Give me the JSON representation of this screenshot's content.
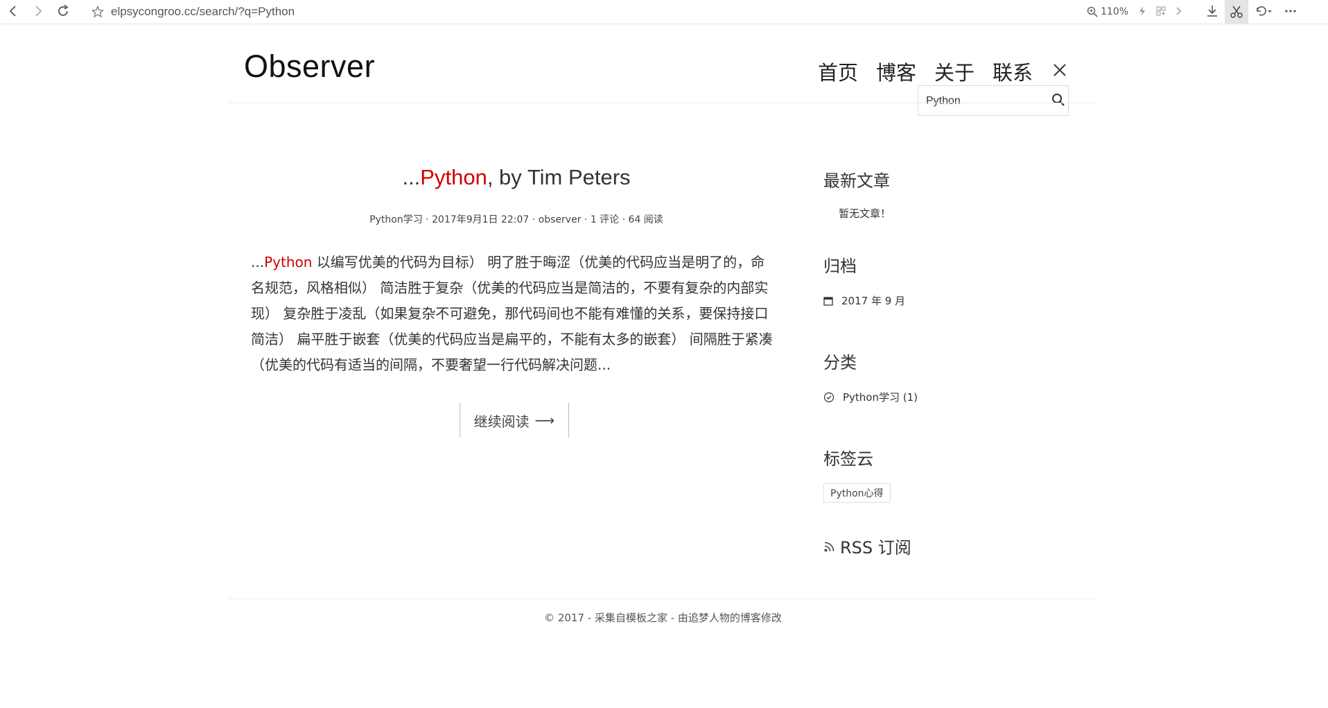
{
  "browser": {
    "url": "elpsycongroo.cc/search/?q=Python",
    "zoom": "110%",
    "icons": [
      "back-icon",
      "forward-icon",
      "reload-icon",
      "star-icon",
      "zoom-icon",
      "lightning-icon",
      "qr-icon",
      "chevron-right-icon",
      "download-icon",
      "scissors-icon",
      "undo-icon",
      "more-icon"
    ]
  },
  "site": {
    "title": "Observer"
  },
  "nav": {
    "items": [
      "首页",
      "博客",
      "关于",
      "联系"
    ]
  },
  "search": {
    "value": "Python"
  },
  "post": {
    "title_prefix": "...",
    "title_highlight": "Python",
    "title_rest": ", by Tim Peters",
    "meta": {
      "category": "Python学习",
      "sep1": " · ",
      "date": "2017年9月1日 22:07",
      "sep2": " · ",
      "author": "observer",
      "sep3": " · ",
      "comments": "1 评论",
      "sep4": " · ",
      "views": "64 阅读"
    },
    "excerpt_prefix": "...",
    "excerpt_highlight": "Python",
    "excerpt_rest": " 以编写优美的代码为目标） 明了胜于晦涩（优美的代码应当是明了的，命名规范，风格相似） 简洁胜于复杂（优美的代码应当是简洁的，不要有复杂的内部实现） 复杂胜于凌乱（如果复杂不可避免，那代码间也不能有难懂的关系，要保持接口简洁） 扁平胜于嵌套（优美的代码应当是扁平的，不能有太多的嵌套） 间隔胜于紧凑（优美的代码有适当的间隔，不要奢望一行代码解决问题...",
    "read_more": "继续阅读",
    "read_more_arrow": "⟶"
  },
  "sidebar": {
    "recent": {
      "title": "最新文章",
      "empty": "暂无文章！"
    },
    "archive": {
      "title": "归档",
      "items": [
        "2017 年 9 月"
      ]
    },
    "categories": {
      "title": "分类",
      "items": [
        "Python学习 (1)"
      ]
    },
    "tags": {
      "title": "标签云",
      "items": [
        "Python心得"
      ]
    },
    "rss": {
      "label": "RSS 订阅"
    }
  },
  "footer": {
    "copyright": "© 2017 - ",
    "link1": "采集自模板之家",
    "sep": " - ",
    "link2": "由追梦人物的博客修改"
  }
}
